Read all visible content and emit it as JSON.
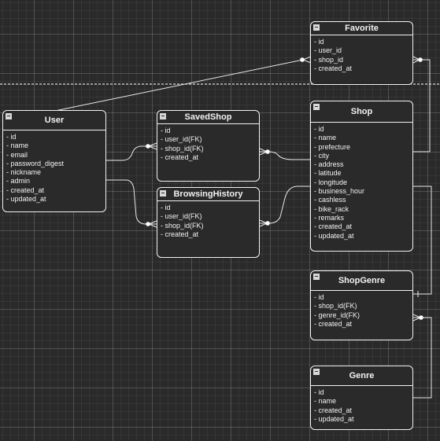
{
  "entities": {
    "favorite": {
      "title": "Favorite",
      "fields": [
        "- id",
        "- user_id",
        "- shop_id",
        "- created_at"
      ]
    },
    "user": {
      "title": "User",
      "fields": [
        "- id",
        "- name",
        "- email",
        "- password_digest",
        "- nickname",
        "- admin",
        "- created_at",
        "- updated_at"
      ]
    },
    "saved_shop": {
      "title": "SavedShop",
      "fields": [
        "- id",
        "- user_id(FK)",
        "- shop_id(FK)",
        "- created_at"
      ]
    },
    "shop": {
      "title": "Shop",
      "fields": [
        "- id",
        "- name",
        "- prefecture",
        "- city",
        "- address",
        "- latitude",
        "- longitude",
        "- business_hour",
        "- cashless",
        "- bike_rack",
        "- remarks",
        "- created_at",
        "- updated_at"
      ]
    },
    "browsing_history": {
      "title": "BrowsingHistory",
      "fields": [
        "- id",
        "- user_id(FK)",
        "- shop_id(FK)",
        "- created_at"
      ]
    },
    "shop_genre": {
      "title": "ShopGenre",
      "fields": [
        "- id",
        "- shop_id(FK)",
        "- genre_id(FK)",
        "- created_at"
      ]
    },
    "genre": {
      "title": "Genre",
      "fields": [
        "- id",
        "- name",
        "- created_at",
        "- updated_at"
      ]
    }
  },
  "relationships": [
    {
      "from": "user",
      "to": "favorite",
      "kind": "one-to-many"
    },
    {
      "from": "user",
      "to": "saved_shop",
      "kind": "one-to-many"
    },
    {
      "from": "user",
      "to": "browsing_history",
      "kind": "one-to-many"
    },
    {
      "from": "shop",
      "to": "saved_shop",
      "kind": "one-to-many"
    },
    {
      "from": "shop",
      "to": "browsing_history",
      "kind": "one-to-many"
    },
    {
      "from": "shop",
      "to": "favorite",
      "kind": "one-to-many"
    },
    {
      "from": "shop",
      "to": "shop_genre",
      "kind": "one-to-many"
    },
    {
      "from": "genre",
      "to": "shop_genre",
      "kind": "one-to-many"
    }
  ],
  "colors": {
    "background": "#2a2a2a",
    "line": "#f2f2f2"
  }
}
